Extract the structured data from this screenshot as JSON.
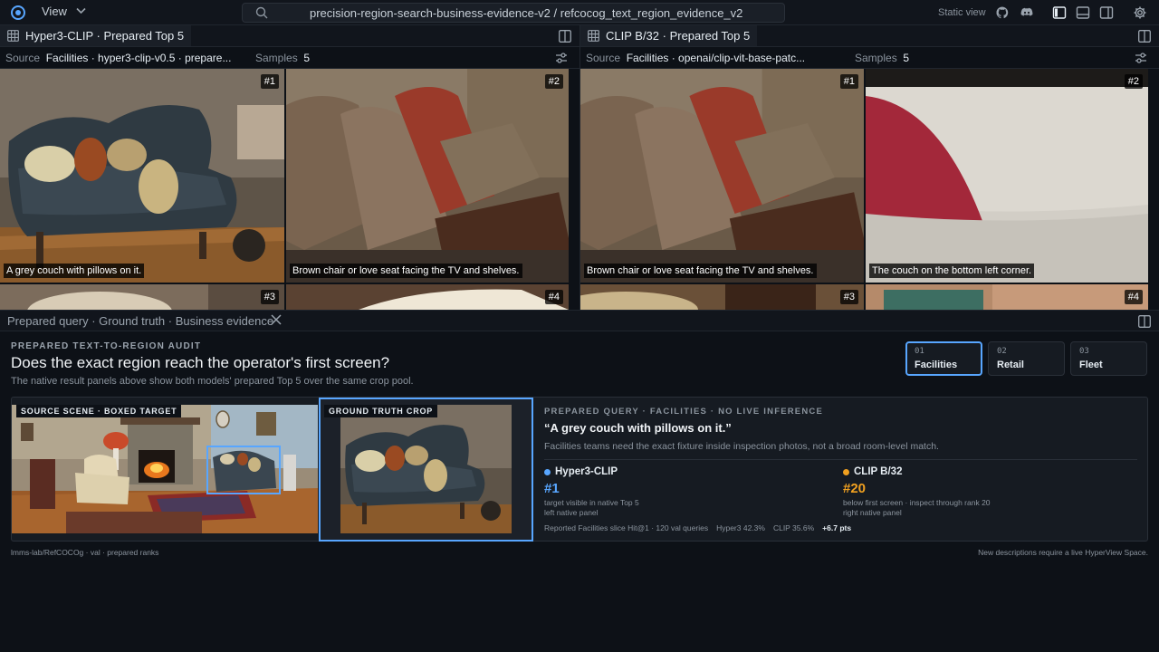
{
  "topbar": {
    "view_label": "View",
    "search_text": "precision-region-search-business-evidence-v2 / refcocog_text_region_evidence_v2",
    "static_view": "Static view"
  },
  "left_panel": {
    "tab_title": "Hyper3-CLIP · Prepared Top 5",
    "source_label": "Source",
    "source_value": "Facilities · hyper3-clip-v0.5 · prepare...",
    "samples_label": "Samples",
    "samples_value": "5",
    "results": [
      {
        "rank": "#1",
        "caption": "A grey couch with pillows on it."
      },
      {
        "rank": "#2",
        "caption": "Brown chair or love seat facing the TV and shelves."
      },
      {
        "rank": "#3",
        "caption": ""
      },
      {
        "rank": "#4",
        "caption": ""
      }
    ]
  },
  "right_panel": {
    "tab_title": "CLIP B/32 · Prepared Top 5",
    "source_label": "Source",
    "source_value": "Facilities · openai/clip-vit-base-patc...",
    "samples_label": "Samples",
    "samples_value": "5",
    "results": [
      {
        "rank": "#1",
        "caption": "Brown chair or love seat facing the TV and shelves."
      },
      {
        "rank": "#2",
        "caption": "The couch on the bottom left corner."
      },
      {
        "rank": "#3",
        "caption": ""
      },
      {
        "rank": "#4",
        "caption": ""
      }
    ]
  },
  "query_bar": {
    "title": "Prepared query · Ground truth · Business evidence"
  },
  "audit": {
    "kicker": "PREPARED TEXT-TO-REGION AUDIT",
    "headline": "Does the exact region reach the operator's first screen?",
    "subline": "The native result panels above show both models' prepared Top 5 over the same crop pool.",
    "segments": [
      {
        "num": "01",
        "name": "Facilities",
        "active": true
      },
      {
        "num": "02",
        "name": "Retail",
        "active": false
      },
      {
        "num": "03",
        "name": "Fleet",
        "active": false
      }
    ],
    "scene_tag": "SOURCE SCENE · BOXED TARGET",
    "gt_tag": "GROUND TRUTH CROP",
    "detail_kicker": "PREPARED QUERY · FACILITIES · NO LIVE INFERENCE",
    "quote": "“A grey couch with pillows on it.”",
    "description": "Facilities teams need the exact fixture inside inspection photos, not a broad room-level match.",
    "models": [
      {
        "name": "Hyper3-CLIP",
        "color": "#58a6ff",
        "rank": "#1",
        "note1": "target visible in native Top 5",
        "note2": "left native panel"
      },
      {
        "name": "CLIP B/32",
        "color": "#f0a020",
        "rank": "#20",
        "note1": "below first screen · inspect through rank 20",
        "note2": "right native panel"
      }
    ],
    "stats": {
      "reported": "Reported Facilities slice Hit@1 · 120 val queries",
      "hyper3": "Hyper3 42.3%",
      "clip": "CLIP 35.6%",
      "delta": "+6.7 pts"
    }
  },
  "footer": {
    "left": "lmms-lab/RefCOCOg · val · prepared ranks",
    "right": "New descriptions require a live HyperView Space."
  }
}
